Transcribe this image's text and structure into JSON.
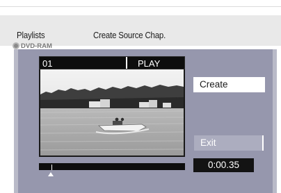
{
  "header": {
    "section": "Playlists",
    "function": "Create Source Chap."
  },
  "disc": {
    "icon": "disc-icon",
    "label": "DVD-RAM"
  },
  "player": {
    "title_number": "01",
    "status": "PLAY"
  },
  "actions": {
    "create": "Create",
    "exit": "Exit"
  },
  "time": "0:00.35",
  "colors": {
    "panel": "#9697ad",
    "panel_edge": "#b9bac8",
    "header": "#e9e9e9",
    "exit_button": "#acadbf",
    "black": "#0d0d0d"
  }
}
